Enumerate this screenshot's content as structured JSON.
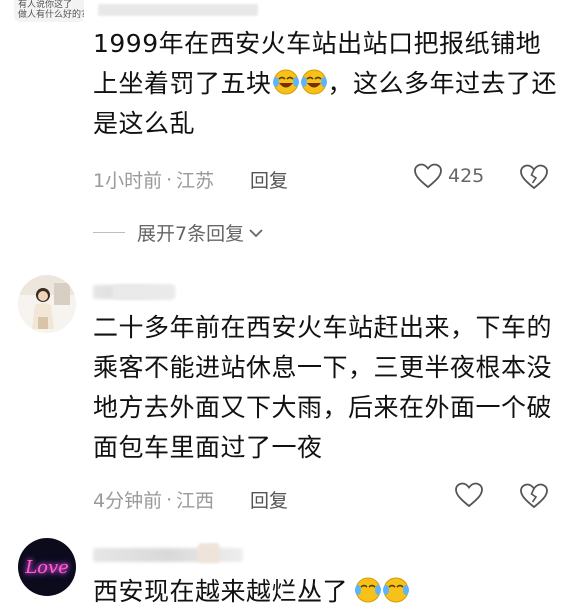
{
  "top_comment": {
    "avatar_lines": [
      "有人说你这了",
      "做人有什么好的?"
    ],
    "text_before_emoji": "1999年在西安火车站出站口把报纸铺地上坐着罚了五块",
    "text_after_emoji": "，这么多年过去了还是这么乱",
    "time": "1小时前",
    "location": "江苏",
    "reply_label": "回复",
    "like_count": "425",
    "expand_label": "展开7条回复"
  },
  "comment_2": {
    "text": "二十多年前在西安火车站赶出来，下车的乘客不能进站休息一下，三更半夜根本没地方去外面又下大雨，后来在外面一个破面包车里面过了一夜",
    "time": "4分钟前",
    "location": "江西",
    "reply_label": "回复"
  },
  "comment_3": {
    "avatar_text": "Love",
    "text": "西安现在越来越烂丛了"
  },
  "separator": "·",
  "icons": {
    "like": "heart-outline-icon",
    "dislike": "broken-heart-icon",
    "chevron": "chevron-down-icon",
    "emoji": "laughing-tears-emoji"
  },
  "colors": {
    "meta": "#9a9a9a",
    "text": "#111111",
    "emoji": "#f6c21a"
  }
}
